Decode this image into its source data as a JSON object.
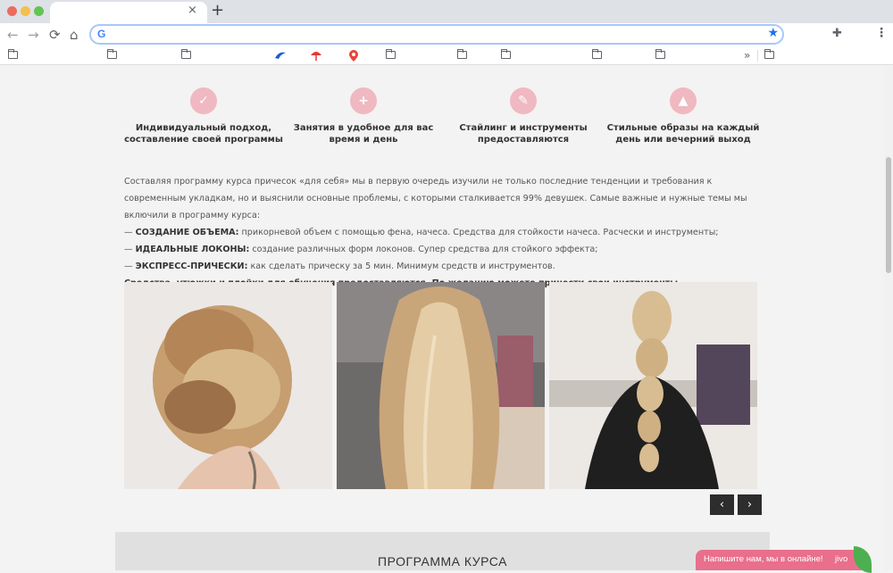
{
  "browser": {
    "tab_close": "×",
    "new_tab": "+",
    "back": "←",
    "forward": "→",
    "reload": "⟳",
    "home": "⌂",
    "google_logo": "G",
    "star": "★",
    "extensions": "✚",
    "menu": "⋮",
    "bookmarks_overflow": "»"
  },
  "features": [
    {
      "icon": "check-icon",
      "glyph": "✓",
      "text": "Индивидуальный подход, составление своей программы"
    },
    {
      "icon": "add-user-icon",
      "glyph": "+",
      "text": "Занятия в удобное для вас время и день"
    },
    {
      "icon": "wand-icon",
      "glyph": "✎",
      "text": "Стайлинг и инструменты предоставляются"
    },
    {
      "icon": "graduation-cap-icon",
      "glyph": "▲",
      "text": "Стильные образы на каждый день или вечерний выход"
    }
  ],
  "description": {
    "intro": "Составляя программу курса причесок «для себя» мы в первую очередь изучили не только последние тенденции и требования к современным укладкам, но и выяснили основные проблемы, с которыми сталкивается 99% девушек. Самые важные и нужные темы мы включили в программу курса:",
    "items": [
      {
        "prefix": "— ",
        "title": "СОЗДАНИЕ ОБЪЕМА:",
        "text": " прикорневой объем с помощью фена, начеса. Средства для стойкости начеса. Расчески и инструменты;"
      },
      {
        "prefix": "— ",
        "title": "ИДЕАЛЬНЫЕ ЛОКОНЫ:",
        "text": " создание различных форм локонов. Супер средства для стойкого эффекта;"
      },
      {
        "prefix": "— ",
        "title": "ЭКСПРЕСС-ПРИЧЕСКИ:",
        "text": " как сделать прическу за 5 мин. Минимум средств и инструментов."
      }
    ],
    "closing": "Средства, утюжки и плойки для обучения предоставляются. По желанию можете принести свои инструменты."
  },
  "gallery": {
    "prev": "‹",
    "next": "›"
  },
  "program": {
    "title": "ПРОГРАММА КУРСА"
  },
  "chat": {
    "text": "Напишите нам, мы в онлайне!",
    "brand": "jivo"
  },
  "colors": {
    "accent_pink": "#f0b8c0",
    "chat_pink": "#e96f8c",
    "chat_green": "#4caf50"
  }
}
